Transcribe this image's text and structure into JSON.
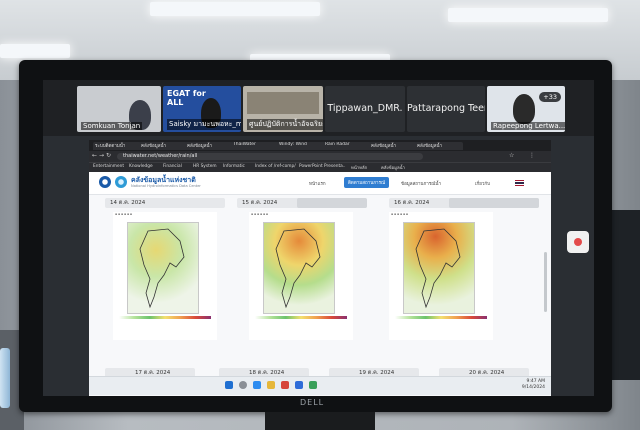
{
  "zoom": {
    "participants": [
      {
        "name": "Somkuan Tonjan"
      },
      {
        "name": "Saisky มามะนพอหะ_mae..",
        "banner": "EGAT for ALL"
      },
      {
        "name": "ศูนย์ปฏิบัติการน้ำอัจฉริยะ วว.."
      },
      {
        "name": "Tippawan_DMR."
      },
      {
        "name": "Pattarapong Teera..."
      },
      {
        "name": "Rapeepong Lertwa...",
        "badge": "+33"
      }
    ]
  },
  "browser": {
    "url": "thaiwater.net/weather/rain/all",
    "tabs": [
      "ระบบติดตามน้ำ",
      "คลังข้อมูลน้ำ",
      "คลังข้อมูลน้ำ",
      "ThaiWater",
      "Windy: Wind",
      "Rain Radar",
      "คลังข้อมูลน้ำ",
      "คลังข้อมูลน้ำ"
    ],
    "bookmarks": [
      "Entertainment",
      "Knowledge",
      "Financial",
      "HR System",
      "Informatic",
      "Index of /ref-comp/",
      "PowerPoint Presenta..",
      "หน้าหลัก",
      "คลังข้อมูลน้ำ"
    ]
  },
  "site": {
    "title": "คลังข้อมูลน้ำแห่งชาติ",
    "subtitle": "National Hydroinformatics Data Center",
    "menu": [
      "หน้าแรก",
      "ติดตามสถานการณ์",
      "ข้อมูลสถานการณ์น้ำ",
      "เกี่ยวกับ"
    ],
    "dates_row1": [
      "14 ต.ค. 2024",
      "15 ต.ค. 2024",
      "16 ต.ค. 2024"
    ],
    "dates_row2": [
      "17 ต.ค. 2024",
      "18 ต.ค. 2024",
      "19 ต.ค. 2024",
      "20 ต.ค. 2024"
    ]
  },
  "taskbar": {
    "time": "9:47 AM",
    "date": "9/14/2024"
  },
  "monitor": {
    "brand": "DELL"
  }
}
